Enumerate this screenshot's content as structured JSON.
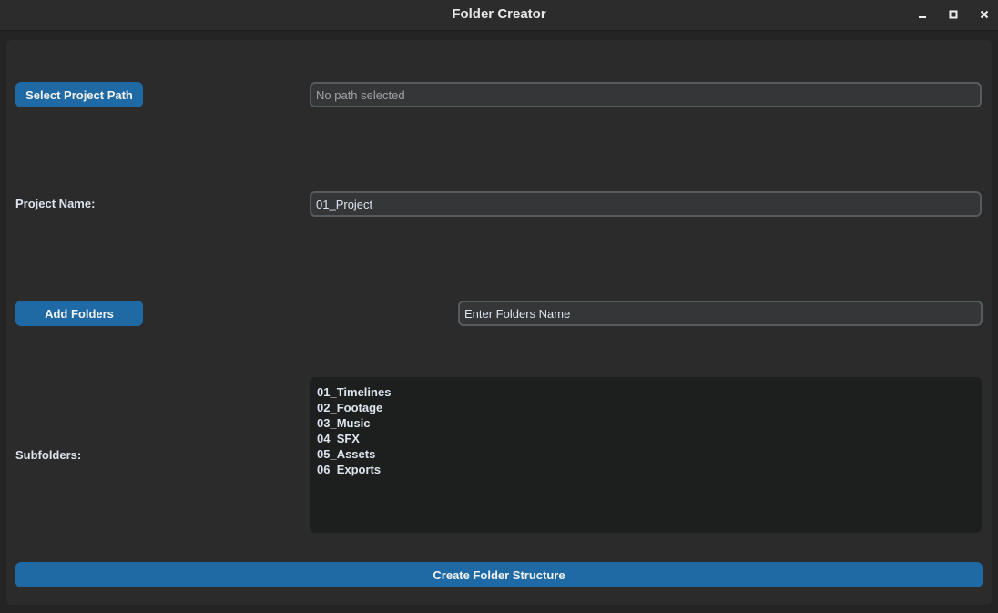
{
  "window": {
    "title": "Folder Creator",
    "controls": [
      "minimize-icon",
      "maximize-icon",
      "close-icon"
    ]
  },
  "path": {
    "button_label": "Select Project Path",
    "field_value": "No path selected"
  },
  "project": {
    "label": "Project Name:",
    "value": "01_Project"
  },
  "folders": {
    "button_label": "Add Folders",
    "input_value": "Enter Folders Name"
  },
  "subfolders": {
    "label": "Subfolders:",
    "items": [
      "01_Timelines",
      "02_Footage",
      "03_Music",
      "04_SFX",
      "05_Assets",
      "06_Exports"
    ]
  },
  "create": {
    "button_label": "Create Folder Structure"
  },
  "colors": {
    "accent": "#1f6aa5",
    "background": "#242424",
    "panel": "#2b2b2b",
    "field": "#343638",
    "textbox": "#1d1e1e"
  }
}
